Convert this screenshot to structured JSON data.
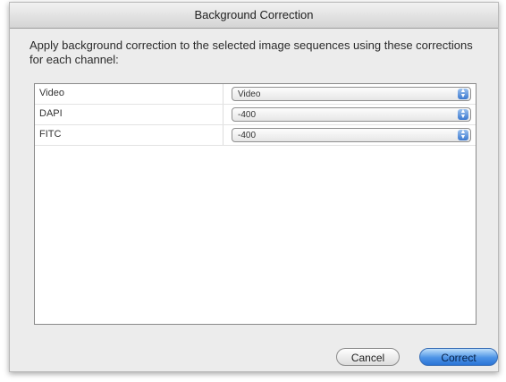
{
  "window": {
    "title": "Background Correction"
  },
  "prompt": "Apply background correction to the selected image sequences using these corrections for each channel:",
  "rows": [
    {
      "label": "Video",
      "value": "Video"
    },
    {
      "label": "DAPI",
      "value": "-400"
    },
    {
      "label": "FITC",
      "value": "-400"
    }
  ],
  "buttons": {
    "cancel": "Cancel",
    "correct": "Correct"
  },
  "icons": {
    "popup_arrows": "up-down-arrows-icon"
  },
  "colors": {
    "accent": "#2b74d6"
  }
}
